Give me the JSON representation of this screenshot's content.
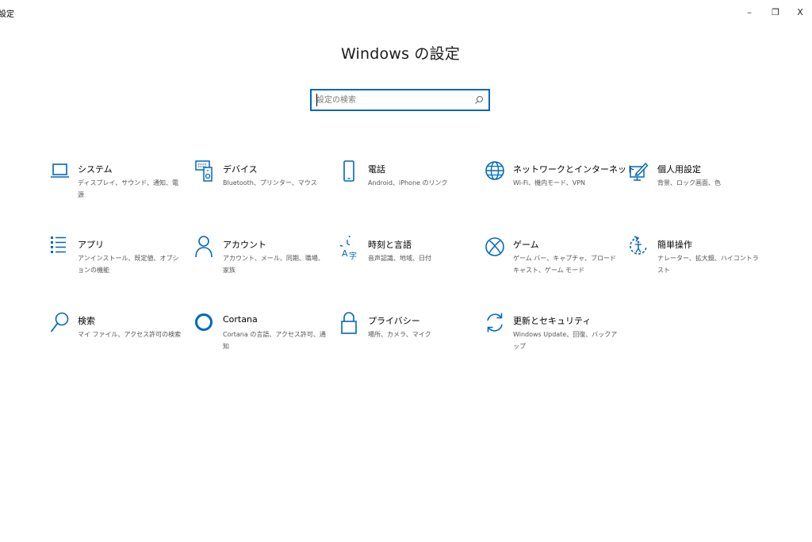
{
  "window": {
    "title": "設定",
    "minimize_label": "–",
    "maximize_label": "❐",
    "close_label": "X"
  },
  "page": {
    "title": "Windows の設定"
  },
  "search": {
    "placeholder": "設定の検索",
    "value": ""
  },
  "accent_color": "#0067c0",
  "tiles": [
    {
      "name": "システム",
      "desc": "ディスプレイ、サウンド、通知、電源",
      "icon": "laptop-icon"
    },
    {
      "name": "デバイス",
      "desc": "Bluetooth、プリンター、マウス",
      "icon": "devices-icon"
    },
    {
      "name": "電話",
      "desc": "Android、iPhone のリンク",
      "icon": "phone-icon"
    },
    {
      "name": "ネットワークとインターネット",
      "desc": "Wi-Fi、機内モード、VPN",
      "icon": "globe-icon"
    },
    {
      "name": "個人用設定",
      "desc": "背景、ロック画面、色",
      "icon": "personalization-icon"
    },
    {
      "name": "アプリ",
      "desc": "アンインストール、既定値、オプションの機能",
      "icon": "apps-list-icon"
    },
    {
      "name": "アカウント",
      "desc": "アカウント、メール、同期、職場、家族",
      "icon": "person-icon"
    },
    {
      "name": "時刻と言語",
      "desc": "音声認識、地域、日付",
      "icon": "time-language-icon"
    },
    {
      "name": "ゲーム",
      "desc": "ゲーム バー、キャプチャ、ブロードキャスト、ゲーム モード",
      "icon": "xbox-icon"
    },
    {
      "name": "簡単操作",
      "desc": "ナレーター、拡大鏡、ハイコントラスト",
      "icon": "ease-of-access-icon"
    },
    {
      "name": "検索",
      "desc": "マイ ファイル、アクセス許可の検索",
      "icon": "search-icon"
    },
    {
      "name": "Cortana",
      "desc": "Cortana の言語、アクセス許可、通知",
      "icon": "cortana-icon"
    },
    {
      "name": "プライバシー",
      "desc": "場所、カメラ、マイク",
      "icon": "lock-icon"
    },
    {
      "name": "更新とセキュリティ",
      "desc": "Windows Update、回復、バックアップ",
      "icon": "sync-icon"
    }
  ]
}
